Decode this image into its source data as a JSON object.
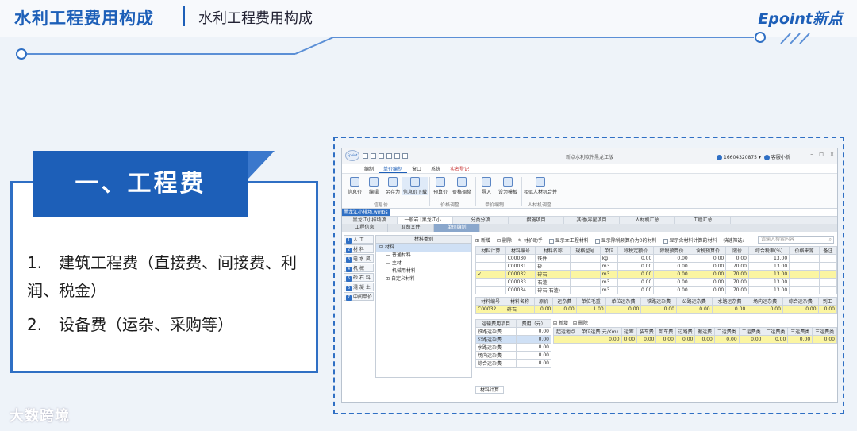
{
  "slide": {
    "title": "水利工程费用构成",
    "subtitle": "水利工程费用构成",
    "brand": "Epoint新点",
    "section_title": "一、工程费",
    "points": [
      {
        "num": "1.",
        "text": "建筑工程费（直接费、间接费、利润、税金）"
      },
      {
        "num": "2.",
        "text": "设备费（运杂、采购等）"
      }
    ],
    "watermark": "大数跨境",
    "accent_color": "#1d5fb8"
  },
  "app": {
    "title": "新点水利软件黑龙江版",
    "user": "16604320875",
    "support": "客服小新",
    "menus": [
      "编制",
      "单价编制",
      "窗口",
      "系统",
      "实名登记"
    ],
    "ribbon_buttons": [
      "信息价",
      "编辑",
      "另存为",
      "信息价下载",
      "预算价",
      "价格调整",
      "导入",
      "设为模板",
      "相似人材机合并"
    ],
    "ribbon_groups": [
      "信息价",
      "价格调整",
      "单价编制",
      "人材机调整"
    ],
    "file_tab": "黑龙江小排场.wmbs",
    "tabs_row1": [
      "黑龙江小排场项",
      "一般岩 [黑龙江小...",
      "分类分项",
      "措施项目",
      "其他\\零星项目",
      "人材机汇总",
      "工程汇总"
    ],
    "tabs_row2": [
      "工程信息",
      "取费文件",
      "单价编制"
    ],
    "left_nav": [
      {
        "n": "1",
        "label": "人 工"
      },
      {
        "n": "2",
        "label": "材 料"
      },
      {
        "n": "3",
        "label": "电 水 风"
      },
      {
        "n": "4",
        "label": "机 械"
      },
      {
        "n": "5",
        "label": "砂 石 料"
      },
      {
        "n": "6",
        "label": "混 凝 土"
      },
      {
        "n": "7",
        "label": "中间单价"
      }
    ],
    "tree": {
      "header": "材料类别",
      "items": [
        "材料",
        "普通材料",
        "主材",
        "机械用材料",
        "自定义材料"
      ]
    },
    "toolbar": [
      "新增",
      "删除",
      "材价助手",
      "显示本工程材料",
      "显示除税预算价为0的材料",
      "显示含材料计算的材料",
      "快速筛选:"
    ],
    "search_placeholder": "请输入搜索内容",
    "table1": {
      "headers": [
        "材料计算",
        "材料编号",
        "材料名称",
        "规格型号",
        "单位",
        "除税定额价",
        "除税预算价",
        "含税预算价",
        "限价",
        "综合税率(%)",
        "价格来源",
        "备注"
      ],
      "rows": [
        [
          "",
          "C00030",
          "铁件",
          "",
          "kg",
          "0.00",
          "0.00",
          "0.00",
          "0.00",
          "13.00",
          "",
          ""
        ],
        [
          "",
          "C00031",
          "砂",
          "",
          "m3",
          "0.00",
          "0.00",
          "0.00",
          "70.00",
          "13.00",
          "",
          ""
        ],
        [
          "✓",
          "C00032",
          "碎石",
          "",
          "m3",
          "0.00",
          "0.00",
          "0.00",
          "70.00",
          "13.00",
          "",
          ""
        ],
        [
          "",
          "C00033",
          "石渣",
          "",
          "m3",
          "0.00",
          "0.00",
          "0.00",
          "70.00",
          "13.00",
          "",
          ""
        ],
        [
          "",
          "C00034",
          "碎石(石渣)",
          "",
          "m3",
          "0.00",
          "0.00",
          "0.00",
          "70.00",
          "13.00",
          "",
          ""
        ]
      ]
    },
    "table2": {
      "headers": [
        "材料编号",
        "材料名称",
        "原价",
        "运杂费",
        "单位毛重",
        "单位运杂费",
        "铁路运杂费",
        "公路运杂费",
        "水路运杂费",
        "场内运杂费",
        "综合运杂费",
        "到工"
      ],
      "row": [
        "C00032",
        "碎石",
        "0.00",
        "0.00",
        "1.00",
        "0.00",
        "0.00",
        "0.00",
        "0.00",
        "0.00",
        "0.00",
        "0.00"
      ]
    },
    "table3": {
      "headers": [
        "运输费用项目",
        "费用（元）"
      ],
      "rows": [
        [
          "铁路运杂费",
          "0.00"
        ],
        [
          "公路运杂费",
          "0.00"
        ],
        [
          "水路运杂费",
          "0.00"
        ],
        [
          "场内运杂费",
          "0.00"
        ],
        [
          "综合运杂费",
          "0.00"
        ]
      ]
    },
    "lower_toolbar": [
      "新增",
      "删除"
    ],
    "table4": {
      "headers": [
        "起运地点",
        "单位运费(元/Km)",
        "运距",
        "装车费",
        "卸车费",
        "过路费",
        "搬运费",
        "二运费类",
        "二运费类",
        "二运费类",
        "三运费类",
        "三运费类"
      ],
      "row": [
        "",
        "0.00",
        "0.00",
        "0.00",
        "0.00",
        "0.00",
        "0.00",
        "0.00",
        "0.00",
        "0.00",
        "0.00",
        "0.00"
      ]
    },
    "bottom_tab": "材料计算"
  }
}
